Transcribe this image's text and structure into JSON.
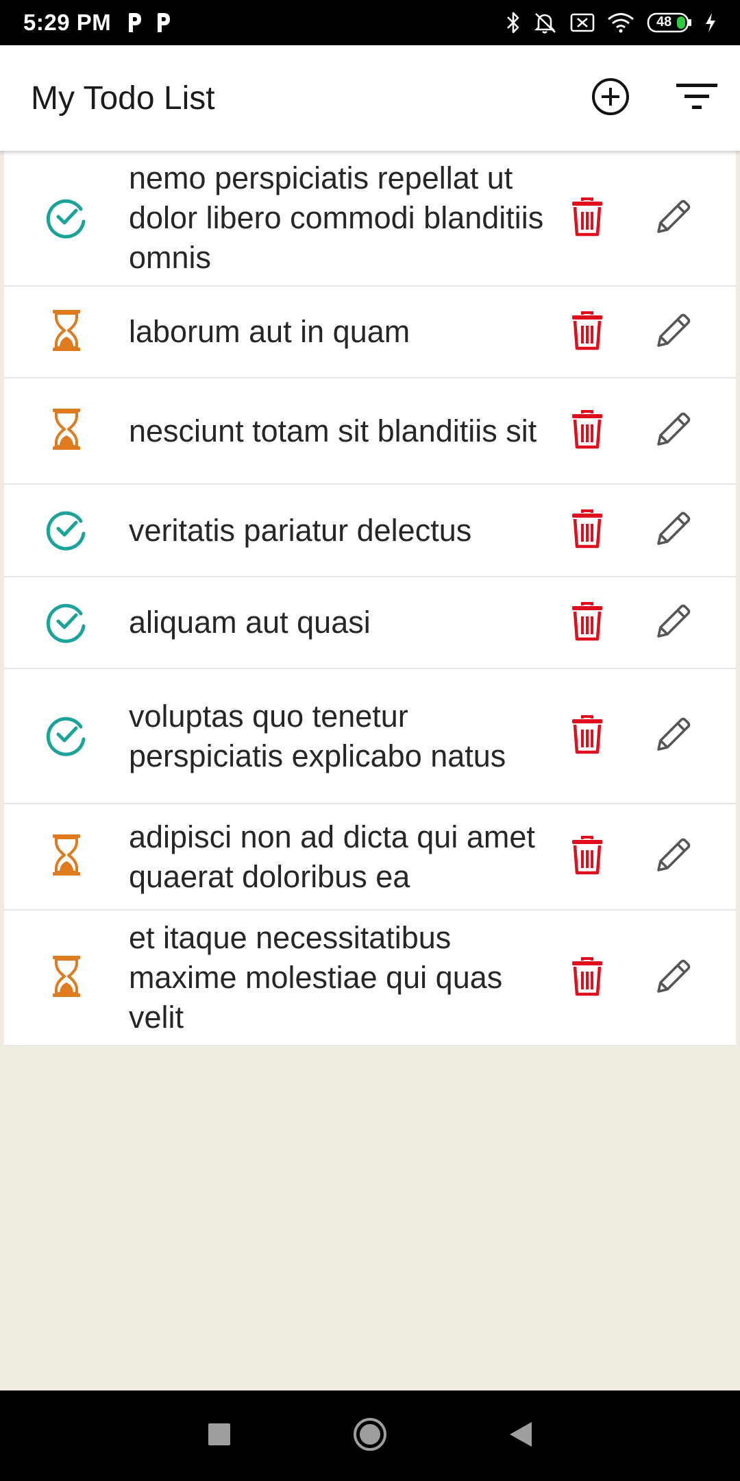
{
  "status_bar": {
    "time": "5:29 PM",
    "battery_level": "48",
    "left_icons": [
      "parking-p-icon",
      "parking-p-icon"
    ],
    "right_icons": [
      "bluetooth-icon",
      "mute-icon",
      "sim-off-icon",
      "wifi-icon",
      "battery-icon",
      "charging-icon"
    ]
  },
  "app_bar": {
    "title": "My Todo List",
    "add_icon": "add-circle-icon",
    "filter_icon": "filter-icon"
  },
  "colors": {
    "done": "#1ba39a",
    "pending": "#e07a1f",
    "delete": "#e10e1e",
    "edit": "#555555",
    "list_background": "#f1ece2"
  },
  "todos": [
    {
      "text": "nemo perspiciatis repellat ut dolor libero commodi blanditiis omnis",
      "status": "done"
    },
    {
      "text": "laborum aut in quam",
      "status": "pending"
    },
    {
      "text": "nesciunt totam sit blanditiis sit",
      "status": "pending"
    },
    {
      "text": "veritatis pariatur delectus",
      "status": "done"
    },
    {
      "text": "aliquam aut quasi",
      "status": "done"
    },
    {
      "text": "voluptas quo tenetur perspiciatis explicabo natus",
      "status": "done"
    },
    {
      "text": "adipisci non ad dicta qui amet quaerat doloribus ea",
      "status": "pending"
    },
    {
      "text": "et itaque necessitatibus maxime molestiae qui quas velit",
      "status": "pending"
    }
  ],
  "nav_bar": {
    "icons": [
      "recents-square-icon",
      "home-circle-icon",
      "back-triangle-icon"
    ]
  }
}
